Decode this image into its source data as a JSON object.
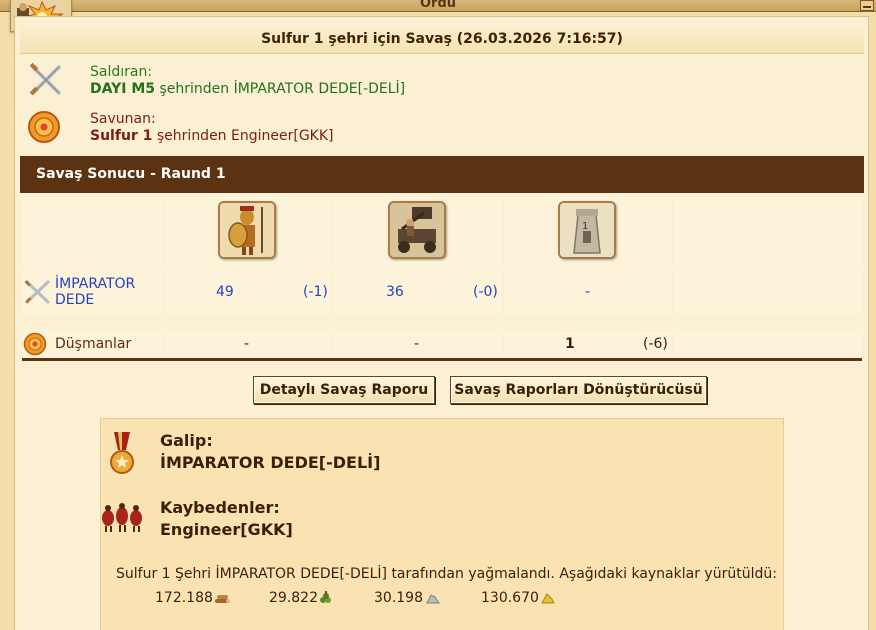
{
  "window": {
    "title": "Ordu"
  },
  "report": {
    "title": "Sulfur 1 şehri için Savaş (26.03.2026 7:16:57)"
  },
  "attacker": {
    "label": "Saldıran:",
    "city": "DAYI M5",
    "from_text": " şehrinden ",
    "player": "İMPARATOR DEDE[-DELİ]"
  },
  "defender": {
    "label": "Savunan:",
    "city": "Sulfur 1",
    "from_text": " şehrinden ",
    "player": "Engineer[GKK]"
  },
  "round": {
    "title": "Savaş Sonucu - Raund 1"
  },
  "rows": {
    "attacker": {
      "name": "İMPARATOR DEDE",
      "u1": "49",
      "u1d": "(-1)",
      "u2": "36",
      "u2d": "(-0)",
      "u3": "-"
    },
    "enemies": {
      "name": "Düşmanlar",
      "u1": "-",
      "u2": "-",
      "u3": "1",
      "u3d": "(-6)"
    }
  },
  "buttons": {
    "detailed": "Detaylı Savaş Raporu",
    "converter": "Savaş Raporları Dönüştürücüsü"
  },
  "verdict": {
    "winner_label": "Galip:",
    "winner": "İMPARATOR DEDE[-DELİ]",
    "loser_label": "Kaybedenler:",
    "loser": "Engineer[GKK]",
    "summary": "Sulfur 1 Şehri İMPARATOR DEDE[-DELİ] tarafından yağmalandı. Aşağıdaki kaynaklar yürütüldü:"
  },
  "resources": [
    {
      "value": "172.188",
      "icon": "wood-icon"
    },
    {
      "value": "29.822",
      "icon": "wine-icon"
    },
    {
      "value": "30.198",
      "icon": "marble-icon"
    },
    {
      "value": "130.670",
      "icon": "sulfur-icon"
    }
  ],
  "colors": {
    "header_brown": "#5b3312",
    "attacker_green": "#23711c",
    "defender_red": "#7c1d12",
    "number_blue": "#2741c7"
  }
}
